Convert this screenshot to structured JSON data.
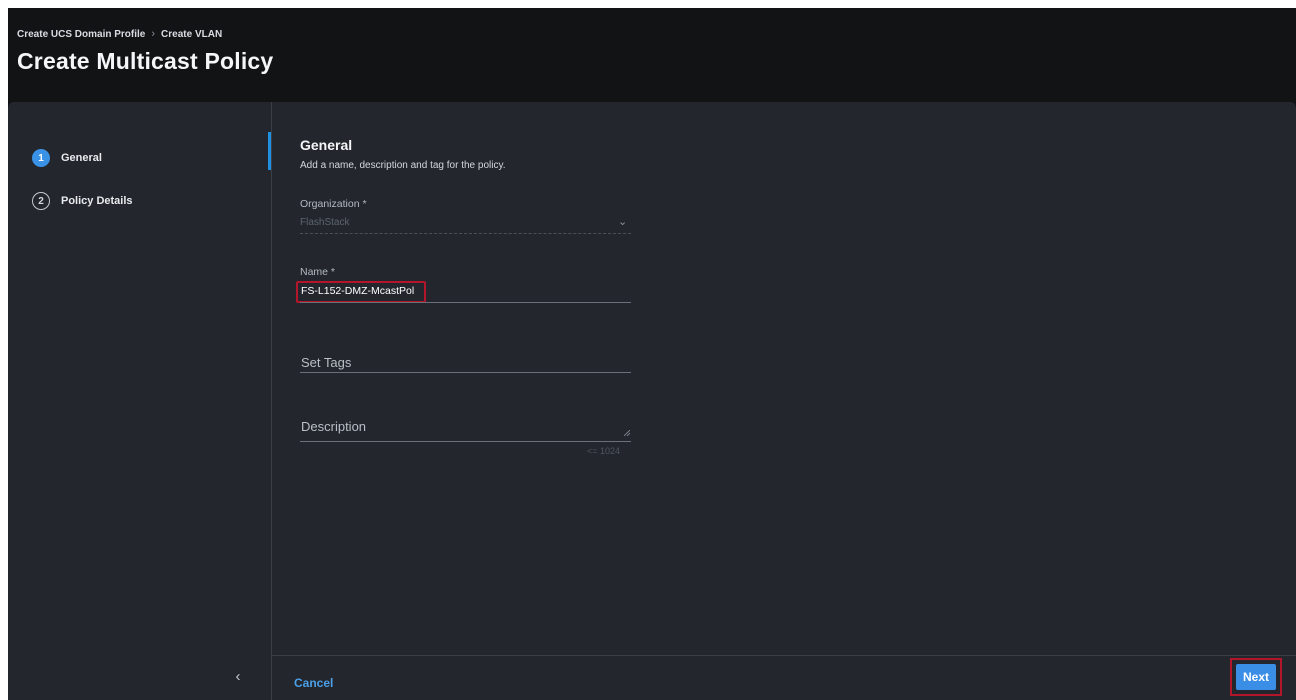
{
  "breadcrumb": [
    "Create UCS Domain Profile",
    "Create VLAN"
  ],
  "page_title": "Create Multicast Policy",
  "steps": [
    {
      "number": "1",
      "label": "General",
      "active": true
    },
    {
      "number": "2",
      "label": "Policy Details",
      "active": false
    }
  ],
  "section": {
    "title": "General",
    "subtitle": "Add a name, description and tag for the policy."
  },
  "fields": {
    "organization": {
      "label": "Organization *",
      "value": "FlashStack"
    },
    "name": {
      "label": "Name *",
      "value": "FS-L152-DMZ-McastPol"
    },
    "tags": {
      "label": "Set Tags"
    },
    "description": {
      "label": "Description",
      "counter": "<= 1024"
    }
  },
  "footer": {
    "cancel_label": "Cancel",
    "next_label": "Next"
  },
  "colors": {
    "accent": "#3a8ee6",
    "highlight": "#b3152a",
    "background": "#23272d"
  },
  "icons": {
    "separator": "chevron-right-icon",
    "collapse": "chevron-left-icon",
    "select": "chevron-down-icon"
  }
}
